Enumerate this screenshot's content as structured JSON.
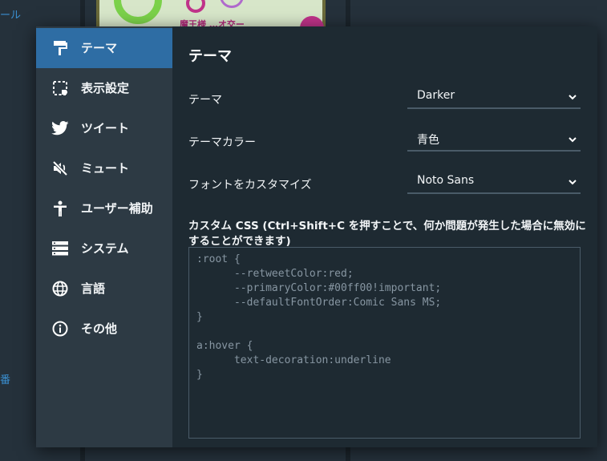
{
  "background": {
    "left_text_top": "ール",
    "left_text_bottom": "番",
    "image_caption": "魔王様 …オ交ー"
  },
  "sidebar": {
    "items": [
      {
        "label": "テーマ",
        "icon": "paint-roller-icon",
        "active": true
      },
      {
        "label": "表示設定",
        "icon": "display-settings-icon",
        "active": false
      },
      {
        "label": "ツイート",
        "icon": "twitter-bird-icon",
        "active": false
      },
      {
        "label": "ミュート",
        "icon": "mute-icon",
        "active": false
      },
      {
        "label": "ユーザー補助",
        "icon": "accessibility-icon",
        "active": false
      },
      {
        "label": "システム",
        "icon": "system-icon",
        "active": false
      },
      {
        "label": "言語",
        "icon": "globe-icon",
        "active": false
      },
      {
        "label": "その他",
        "icon": "info-icon",
        "active": false
      }
    ]
  },
  "content": {
    "title": "テーマ",
    "theme": {
      "label": "テーマ",
      "value": "Darker"
    },
    "theme_color": {
      "label": "テーマカラー",
      "value": "青色"
    },
    "font": {
      "label": "フォントをカスタマイズ",
      "value": "Noto Sans"
    },
    "custom_css": {
      "label": "カスタム CSS (Ctrl+Shift+C を押すことで、何か問題が発生した場合に無効にすることができます)",
      "value": ":root {\n      --retweetColor:red;\n      --primaryColor:#00ff00!important;\n      --defaultFontOrder:Comic Sans MS;\n}\n\na:hover {\n      text-decoration:underline\n}"
    }
  },
  "colors": {
    "accent": "#2e6da4",
    "modal_bg": "#1e2a32",
    "sidebar_bg": "#2d3a44"
  }
}
